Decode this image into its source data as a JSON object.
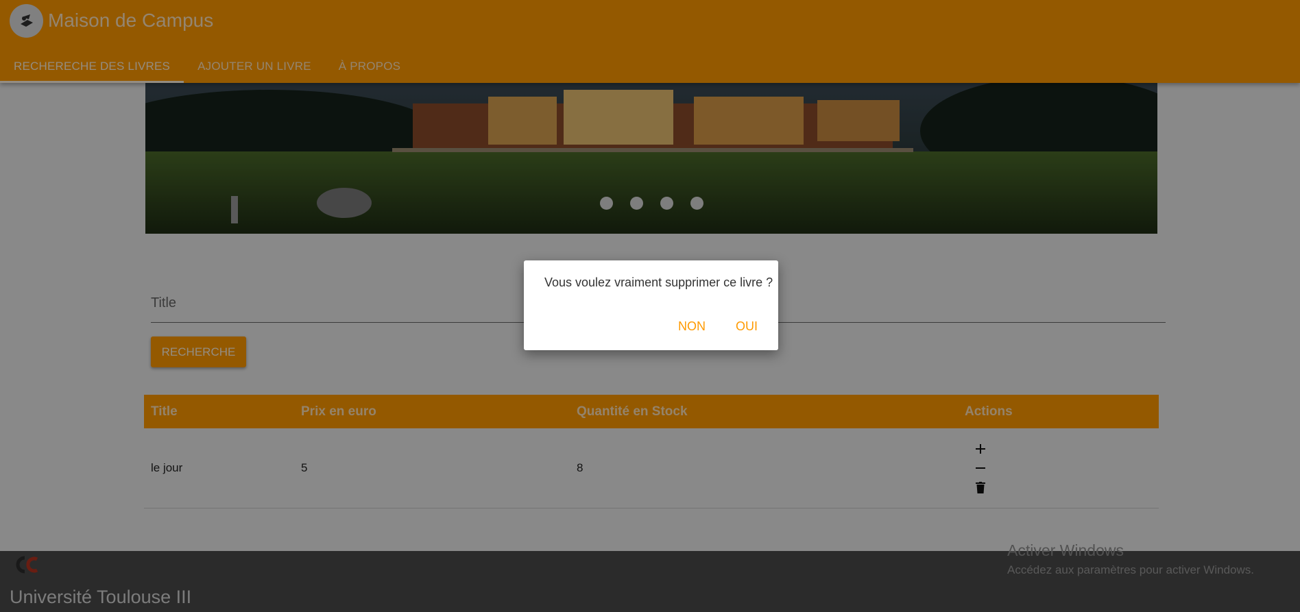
{
  "header": {
    "title": "Maison de Campus",
    "logo_icon": "book-reader-icon",
    "tabs": [
      {
        "label": "RECHERECHE DES LIVRES",
        "active": true
      },
      {
        "label": "AJOUTER UN LIVRE",
        "active": false
      },
      {
        "label": "À PROPOS",
        "active": false
      }
    ]
  },
  "banner": {
    "slide_count": 4
  },
  "search": {
    "placeholder": "Title",
    "button_label": "RECHERCHE"
  },
  "table": {
    "headers": [
      "Title",
      "Prix en euro",
      "Quantité en Stock",
      "Actions"
    ],
    "rows": [
      {
        "title": "le jour",
        "price": "5",
        "stock": "8",
        "actions": [
          "plus-icon",
          "minus-icon",
          "trash-icon"
        ]
      }
    ]
  },
  "footer": {
    "title": "Université Toulouse III",
    "logo_icon": "university-logo-icon"
  },
  "windows_notice": {
    "title": "Activer Windows",
    "subtitle": "Accédez aux paramètres pour activer Windows."
  },
  "dialog": {
    "message": "Vous voulez vraiment supprimer ce livre ?",
    "cancel_label": "NON",
    "confirm_label": "OUI"
  },
  "colors": {
    "primary": "#ff9a00",
    "footer": "#4a4a4a"
  }
}
